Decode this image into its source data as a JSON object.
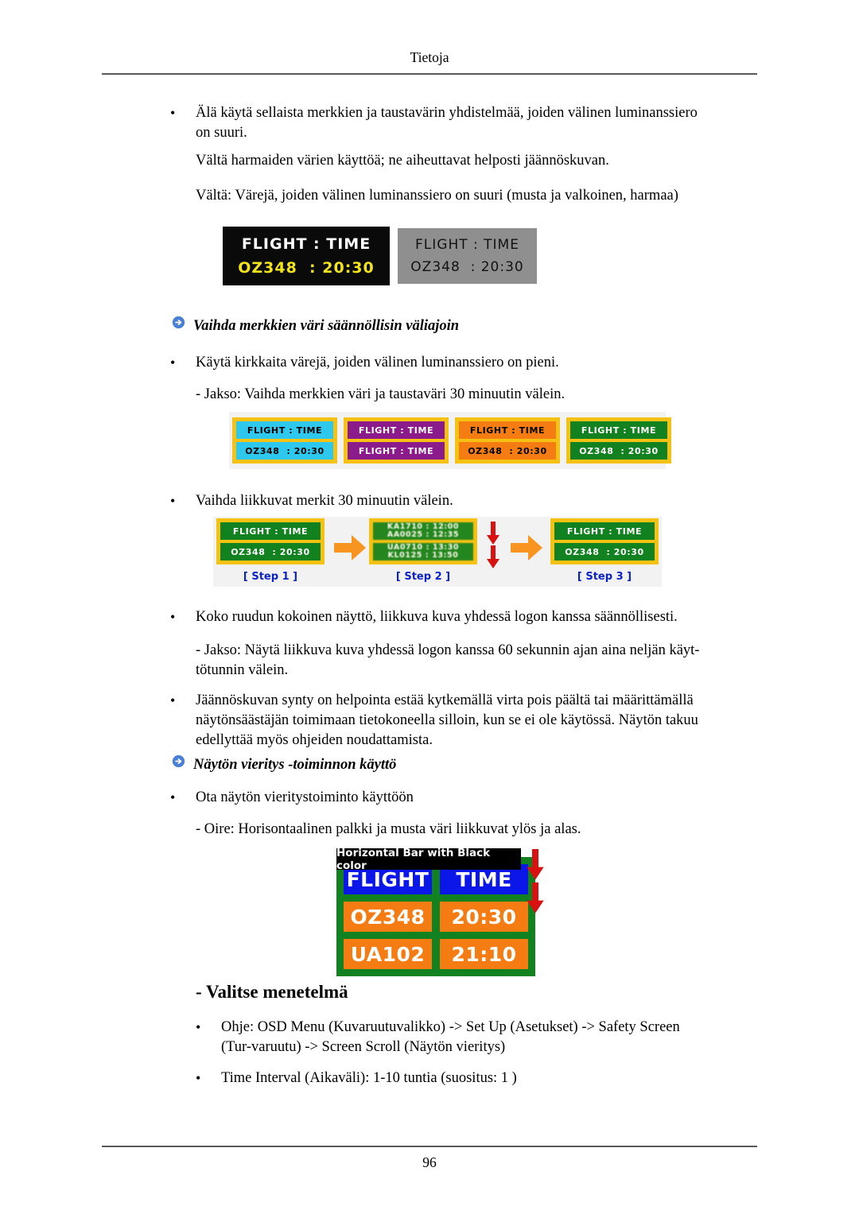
{
  "page": {
    "running_head": "Tietoja",
    "folio": "96"
  },
  "colors": {
    "arrow_bullet": "#4a7fd6",
    "panel_border": "#f5c213",
    "green": "#12811f",
    "cyan": "#2ec8ef",
    "purple": "#8b1a8b",
    "orange": "#f57c12",
    "blue": "#0b16e8",
    "red_arrow": "#d81111",
    "step_label": "#0c22c8",
    "gray_panel": "#8f8f8f",
    "yellow_text": "#f2e41a"
  },
  "body": {
    "bullet_glyph": "•",
    "b1": "Älä käytä sellaista merkkien ja taustavärin yhdistelmää, joiden välinen luminanssiero on suuri.",
    "p1": "Vältä harmaiden värien käyttöä; ne aiheuttavat helposti jäännöskuvan.",
    "p2": "Vältä: Värejä, joiden välinen luminanssiero on suuri (musta ja valkoinen, harmaa)",
    "head1": "Vaihda merkkien väri säännöllisin väliajoin",
    "b2": "Käytä kirkkaita värejä, joiden välinen luminanssiero on pieni.",
    "p3": "- Jakso: Vaihda merkkien väri ja taustaväri 30 minuutin välein.",
    "b3": "Vaihda liikkuvat merkit 30 minuutin välein.",
    "b4": "Koko ruudun kokoinen näyttö, liikkuva kuva yhdessä logon kanssa säännöllisesti.",
    "p4": "- Jakso: Näytä liikkuva kuva yhdessä logon kanssa 60 sekunnin ajan aina neljän käyt-tötunnin välein.",
    "b5": "Jäännöskuvan synty on helpointa estää kytkemällä virta pois päältä tai määrittämällä näytönsäästäjän toimimaan tietokoneella silloin, kun se ei ole käytössä. Näytön takuu edellyttää myös ohjeiden noudattamista.",
    "head2": "Näytön vieritys -toiminnon käyttö",
    "b6": "Ota näytön vieritystoiminto käyttöön",
    "p5": "- Oire: Horisontaalinen palkki ja musta väri liikkuvat ylös ja alas.",
    "section_title": "- Valitse menetelmä",
    "b7": "Ohje: OSD Menu (Kuvaruutuvalikko) -> Set Up (Asetukset) -> Safety Screen (Tur-varuutu) -> Screen Scroll (Näytön vieritys)",
    "b8": "Time Interval (Aikaväli): 1-10 tuntia (suositus: 1 )"
  },
  "fig_contrast": {
    "dark_panel": {
      "line1": "FLIGHT : TIME",
      "line2": "OZ348  : 20:30"
    },
    "gray_panel": {
      "line1": "FLIGHT : TIME",
      "line2": "OZ348  : 20:30"
    }
  },
  "fig_colors": {
    "panels": [
      {
        "name": "cyan",
        "bg": "#2ec8ef",
        "fg": "#000000",
        "line1": "FLIGHT : TIME",
        "line2": "OZ348  : 20:30"
      },
      {
        "name": "purple",
        "bg": "#8b1a8b",
        "fg": "#ffffff",
        "line1": "FLIGHT : TIME",
        "line2": "FLIGHT : TIME"
      },
      {
        "name": "orange",
        "bg": "#f57c12",
        "fg": "#000000",
        "line1": "FLIGHT : TIME",
        "line2": "OZ348  : 20:30"
      },
      {
        "name": "green",
        "bg": "#12811f",
        "fg": "#ffffff",
        "line1": "FLIGHT : TIME",
        "line2": "OZ348  : 20:30"
      }
    ]
  },
  "fig_steps": {
    "step1": {
      "line1": "FLIGHT : TIME",
      "line2": "OZ348  : 20:30",
      "label": "[ Step 1 ]"
    },
    "step2": {
      "blur_a1": "KA1710 : 12:00",
      "blur_a2": "AA0025 : 12:35",
      "blur_b1": "UA0710 : 13:30",
      "blur_b2": "KL0125 : 13:50",
      "label": "[ Step 2 ]"
    },
    "step3": {
      "line1": "FLIGHT : TIME",
      "line2": "OZ348  : 20:30",
      "label": "[ Step 3 ]"
    }
  },
  "fig_bar": {
    "overlay_label": "Horizontal Bar with Black color",
    "rows": [
      {
        "type": "head",
        "left": "FLIGHT",
        "right": "TIME"
      },
      {
        "type": "data",
        "left": "OZ348",
        "right": "20:30"
      },
      {
        "type": "data",
        "left": "UA102",
        "right": "21:10"
      }
    ]
  }
}
